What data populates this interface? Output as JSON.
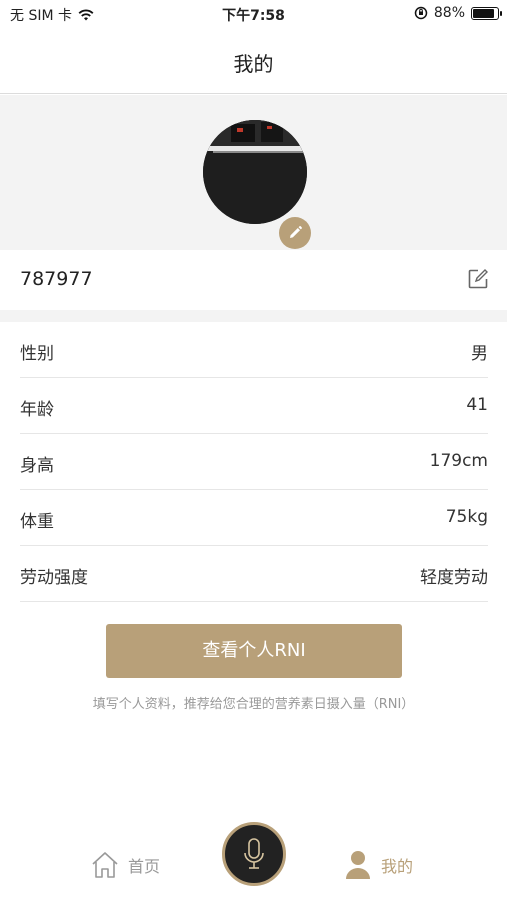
{
  "status_bar": {
    "carrier": "无 SIM 卡",
    "time": "下午7:58",
    "battery": "88%",
    "battery_level": 0.88
  },
  "nav": {
    "title": "我的"
  },
  "profile": {
    "username": "787977"
  },
  "info": [
    {
      "label": "性别",
      "value": "男"
    },
    {
      "label": "年龄",
      "value": "41"
    },
    {
      "label": "身高",
      "value": "179cm"
    },
    {
      "label": "体重",
      "value": "75kg"
    },
    {
      "label": "劳动强度",
      "value": "轻度劳动"
    }
  ],
  "rni": {
    "button_label": "查看个人RNI",
    "hint": "填写个人资料，推荐给您合理的营养素日摄入量（RNI）"
  },
  "tab_bar": {
    "home_label": "首页",
    "mine_label": "我的"
  },
  "colors": {
    "accent": "#b8a079",
    "inactive": "#999999",
    "section_bg": "#f3f3f3"
  }
}
